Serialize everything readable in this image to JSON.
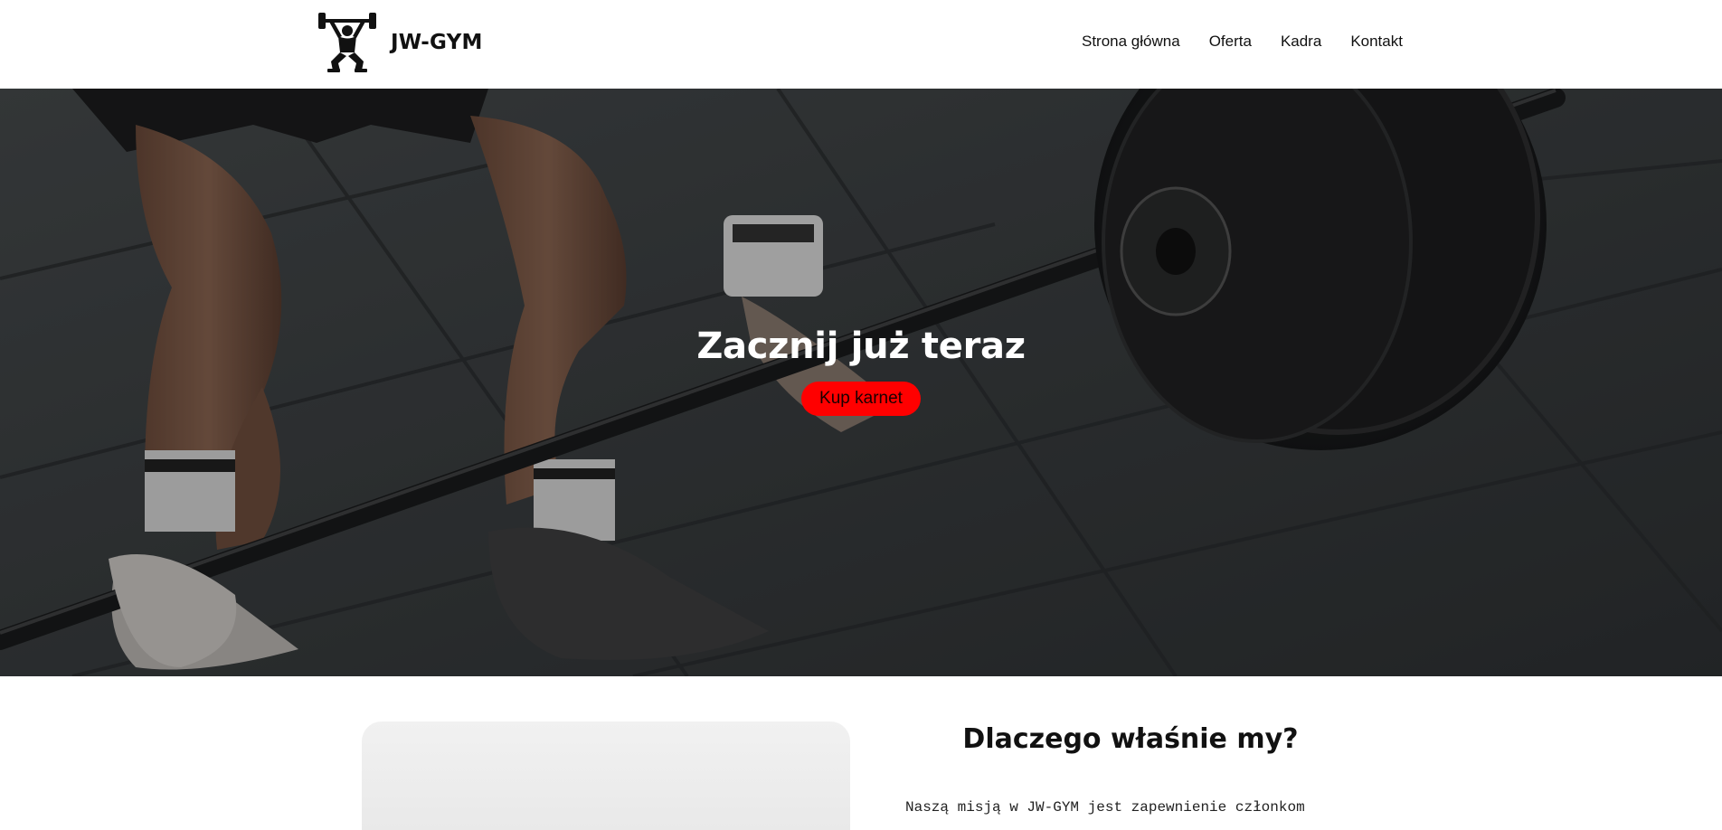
{
  "header": {
    "brand": "JW-GYM",
    "logo_icon": "weightlifter-icon",
    "nav": [
      {
        "label": "Strona główna"
      },
      {
        "label": "Oferta"
      },
      {
        "label": "Kadra"
      },
      {
        "label": "Kontakt"
      }
    ]
  },
  "hero": {
    "title": "Zacznij już teraz",
    "button_label": "Kup karnet",
    "button_color": "#ff0000",
    "background_image": "deadlift-barbell-photo"
  },
  "about": {
    "title": "Dlaczego właśnie my?",
    "text_line": "Naszą misją w JW-GYM jest zapewnienie członkom"
  }
}
